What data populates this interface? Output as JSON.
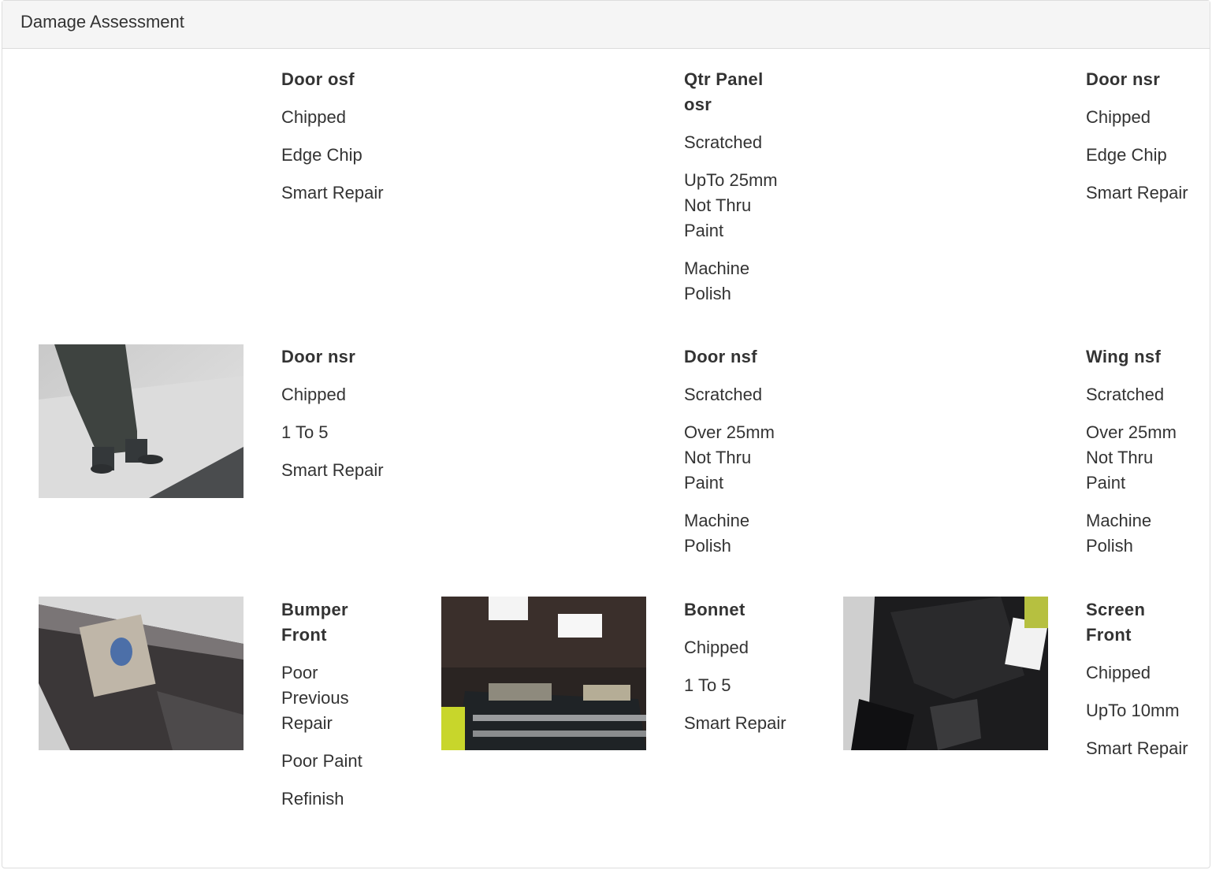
{
  "panel": {
    "title": "Damage Assessment"
  },
  "items": [
    {
      "part": "Door osf",
      "damage": "Chipped",
      "detail": "Edge Chip",
      "action": "Smart Repair"
    },
    {
      "part": "Qtr Panel osr",
      "damage": "Scratched",
      "detail": "UpTo 25mm Not Thru Paint",
      "action": "Machine Polish"
    },
    {
      "part": "Door nsr",
      "damage": "Chipped",
      "detail": "Edge Chip",
      "action": "Smart Repair"
    },
    {
      "part": "Door nsr",
      "damage": "Chipped",
      "detail": "1 To 5",
      "action": "Smart Repair"
    },
    {
      "part": "Door nsf",
      "damage": "Scratched",
      "detail": "Over 25mm Not Thru Paint",
      "action": "Machine Polish"
    },
    {
      "part": "Wing nsf",
      "damage": "Scratched",
      "detail": "Over 25mm Not Thru Paint",
      "action": "Machine Polish"
    },
    {
      "part": "Bumper Front",
      "damage": "Poor Previous Repair",
      "detail": "Poor Paint",
      "action": "Refinish"
    },
    {
      "part": "Bonnet",
      "damage": "Chipped",
      "detail": "1 To 5",
      "action": "Smart Repair"
    },
    {
      "part": "Screen Front",
      "damage": "Chipped",
      "detail": "UpTo 10mm",
      "action": "Smart Repair"
    }
  ]
}
